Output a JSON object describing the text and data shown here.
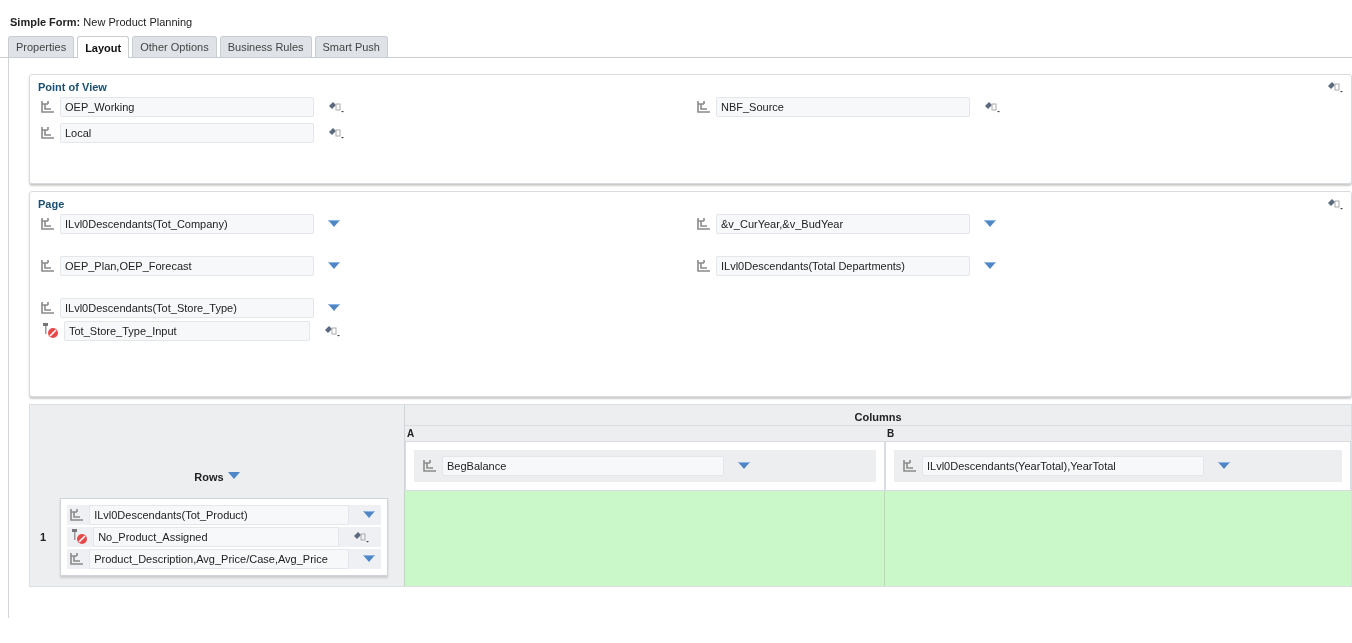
{
  "header": {
    "label": "Simple Form:",
    "title": "New Product Planning"
  },
  "tabs": [
    {
      "label": "Properties",
      "selected": false
    },
    {
      "label": "Layout",
      "selected": true
    },
    {
      "label": "Other Options",
      "selected": false
    },
    {
      "label": "Business Rules",
      "selected": false
    },
    {
      "label": "Smart Push",
      "selected": false
    }
  ],
  "point_of_view": {
    "title": "Point of View",
    "left": [
      {
        "kind": "member",
        "text": "OEP_Working",
        "dropdown": false
      },
      {
        "kind": "member",
        "text": "Local",
        "dropdown": false
      }
    ],
    "right": [
      {
        "kind": "member",
        "text": "NBF_Source",
        "dropdown": false
      }
    ]
  },
  "page": {
    "title": "Page",
    "left": [
      {
        "kind": "member",
        "text": "ILvl0Descendants(Tot_Company)",
        "dropdown": true
      },
      {
        "kind": "member",
        "text": "OEP_Plan,OEP_Forecast",
        "dropdown": true
      },
      {
        "kind": "member",
        "text": "ILvl0Descendants(Tot_Store_Type)",
        "dropdown": true,
        "children": [
          {
            "kind": "exclusion",
            "text": "Tot_Store_Type_Input",
            "dropdown": false
          }
        ]
      }
    ],
    "right": [
      {
        "kind": "member",
        "text": "&v_CurYear,&v_BudYear",
        "dropdown": true
      },
      {
        "kind": "member",
        "text": "ILvl0Descendants(Total Departments)",
        "dropdown": true
      }
    ]
  },
  "grid": {
    "rows_label": "Rows",
    "columns_label": "Columns",
    "columns": [
      {
        "letter": "A",
        "selectors": [
          {
            "kind": "member",
            "text": "BegBalance",
            "dropdown": true
          }
        ]
      },
      {
        "letter": "B",
        "selectors": [
          {
            "kind": "member",
            "text": "ILvl0Descendants(YearTotal),YearTotal",
            "dropdown": true
          }
        ]
      }
    ],
    "rows": [
      {
        "number": "1",
        "selectors": [
          {
            "kind": "member",
            "text": "ILvl0Descendants(Tot_Product)",
            "dropdown": true
          },
          {
            "kind": "exclusion",
            "text": "No_Product_Assigned",
            "dropdown": false
          },
          {
            "kind": "member",
            "text": "Product_Description,Avg_Price/Case,Avg_Price",
            "dropdown": true
          }
        ]
      }
    ]
  }
}
